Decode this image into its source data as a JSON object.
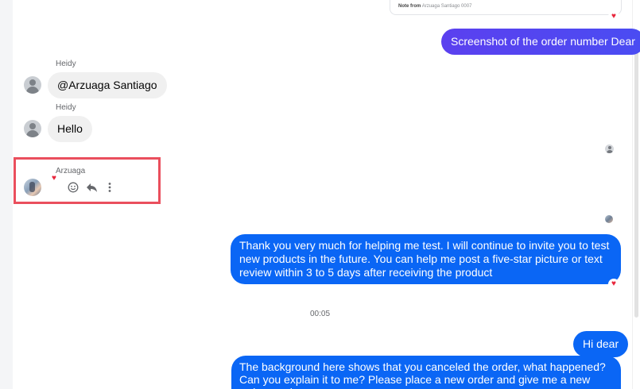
{
  "colors": {
    "outgoing_gradient_top": "#4f4af0",
    "outgoing_blue": "#0a66f5",
    "incoming_bg": "#f0f0f0",
    "heart": "#e8253b",
    "highlight_border": "#ea4f5d"
  },
  "attachment_card": {
    "note_prefix": "Note from",
    "note_text": "Arzuaga Santiago 0007"
  },
  "messages": [
    {
      "id": "m1",
      "direction": "out",
      "text": "Screenshot of the order number Dear"
    },
    {
      "id": "m2",
      "direction": "in",
      "sender": "Heidy",
      "text": "@Arzuaga Santiago"
    },
    {
      "id": "m3",
      "direction": "in",
      "sender": "Heidy",
      "text": "Hello"
    },
    {
      "id": "m4",
      "direction": "in",
      "sender": "Arzuaga",
      "text": ""
    },
    {
      "id": "m5",
      "direction": "out",
      "text": "Thank you very much for helping me test. I will continue to invite you to test new products in the future. You can help me post a five-star picture or text review within 3 to 5 days after receiving the product"
    },
    {
      "id": "m6",
      "direction": "out",
      "text": "Hi dear"
    },
    {
      "id": "m7",
      "direction": "out",
      "text": "The background here shows that you canceled the order, what happened? Can you explain it to me? Please place a new order and give me a new order number"
    }
  ],
  "timestamp": "00:05",
  "reaction_symbol": "♥",
  "message_actions": [
    "emoji-react",
    "reply",
    "more-options"
  ]
}
